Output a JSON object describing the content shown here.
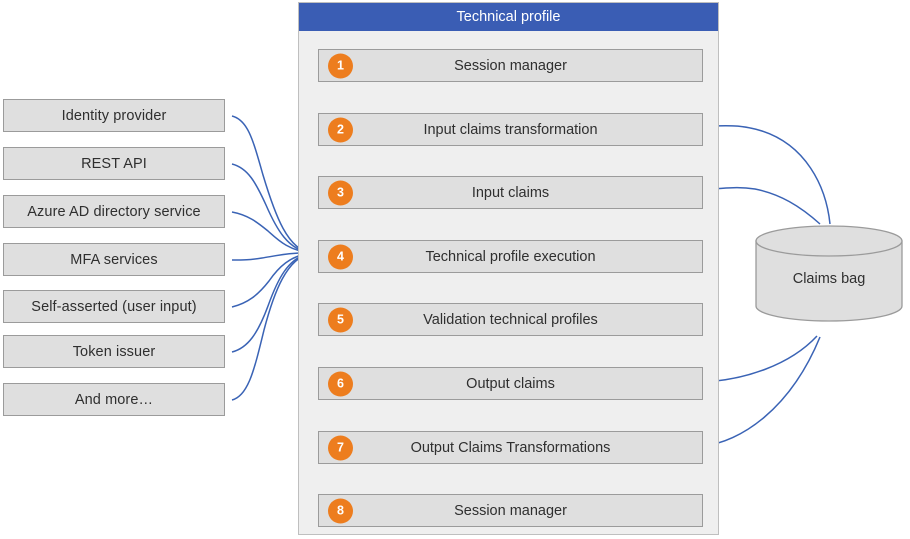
{
  "colors": {
    "header_blue": "#3A5DB4",
    "arrow_blue": "#3A63B5",
    "badge_orange": "#ED7D1E",
    "box_fill": "#DFDFDF",
    "box_border": "#9B9B9B",
    "panel_fill": "#EFEFEF",
    "panel_border": "#BFBFBF",
    "text": "#2F2F2F"
  },
  "panel": {
    "title": "Technical profile",
    "steps": [
      {
        "number": "1",
        "label": "Session manager"
      },
      {
        "number": "2",
        "label": "Input claims transformation"
      },
      {
        "number": "3",
        "label": "Input claims"
      },
      {
        "number": "4",
        "label": "Technical profile execution"
      },
      {
        "number": "5",
        "label": "Validation technical profiles"
      },
      {
        "number": "6",
        "label": "Output claims"
      },
      {
        "number": "7",
        "label": "Output Claims Transformations"
      },
      {
        "number": "8",
        "label": "Session manager"
      }
    ]
  },
  "sources": {
    "items": [
      {
        "label": "Identity provider"
      },
      {
        "label": "REST API"
      },
      {
        "label": "Azure AD directory service"
      },
      {
        "label": "MFA services"
      },
      {
        "label": "Self-asserted (user input)"
      },
      {
        "label": "Token issuer"
      },
      {
        "label": "And more…"
      }
    ]
  },
  "claims_bag": {
    "label": "Claims bag"
  }
}
